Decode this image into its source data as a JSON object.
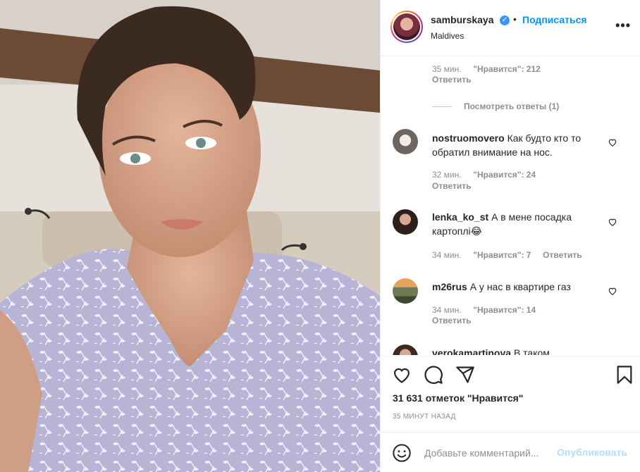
{
  "post": {
    "image_alt": "selfie photo",
    "username": "samburskaya",
    "verified_glyph": "✓",
    "separator": "•",
    "follow_label": "Подписаться",
    "location": "Maldives",
    "more_glyph": "•••"
  },
  "comments_top": {
    "time": "35 мин.",
    "likes": "\"Нравится\": 212",
    "reply": "Ответить",
    "view_replies": "Посмотреть ответы (1)"
  },
  "comments": [
    {
      "username": "nostruomovero",
      "text": "Как будто кто то обратил внимание на нос.",
      "time": "32 мин.",
      "likes": "\"Нравится\": 24",
      "reply": "Ответить"
    },
    {
      "username": "lenka_ko_st",
      "text": "А в мене посадка картоплі😂",
      "time": "34 мин.",
      "likes": "\"Нравится\": 7",
      "reply": "Ответить"
    },
    {
      "username": "m26rus",
      "text": "А у нас в квартире газ",
      "time": "34 мин.",
      "likes": "\"Нравится\": 14",
      "reply": "Ответить"
    },
    {
      "username": "verokamartinova",
      "text": "В таком"
    }
  ],
  "footer": {
    "likes_count": "31 631 отметок \"Нравится\"",
    "timestamp": "35 МИНУТ НАЗАД",
    "comment_placeholder": "Добавьте комментарий...",
    "publish_label": "Опубликовать"
  },
  "colors": {
    "accent": "#0095f6",
    "publish_disabled": "#b2dffc",
    "muted": "#8e8e8e",
    "text": "#262626"
  },
  "icons": [
    "heart-icon",
    "comment-icon",
    "share-icon",
    "bookmark-icon",
    "smile-icon",
    "verified-icon"
  ]
}
